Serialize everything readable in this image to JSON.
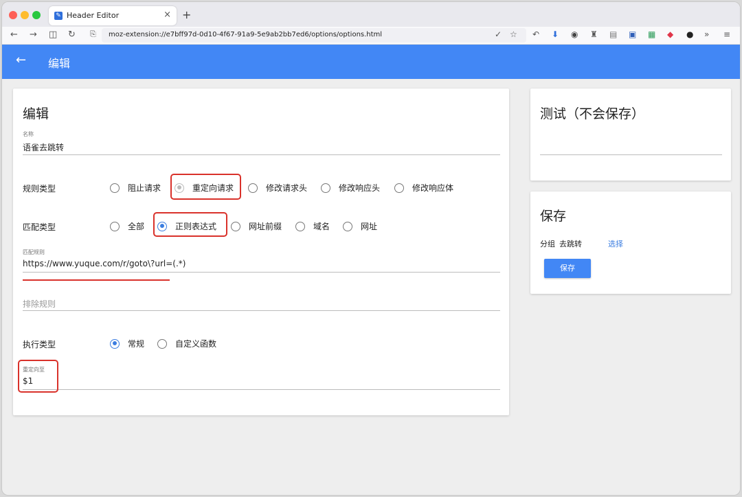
{
  "browser": {
    "tab_title": "Header Editor",
    "tab_close": "×",
    "new_tab": "+",
    "url": "moz-extension://e7bff97d-0d10-4f67-91a9-5e9ab2bb7ed6/options/options.html"
  },
  "appbar": {
    "back": "←",
    "title": "编辑"
  },
  "edit": {
    "title": "编辑",
    "name_label": "名称",
    "name_value": "语雀去跳转",
    "rule_type_label": "规则类型",
    "rule_types": [
      "阻止请求",
      "重定向请求",
      "修改请求头",
      "修改响应头",
      "修改响应体"
    ],
    "rule_type_selected": "重定向请求",
    "match_type_label": "匹配类型",
    "match_types": [
      "全部",
      "正则表达式",
      "网址前缀",
      "域名",
      "网址"
    ],
    "match_type_selected": "正则表达式",
    "match_rule_label": "匹配规则",
    "match_rule_value": "https://www.yuque.com/r/goto\\?url=(.*)",
    "exclude_placeholder": "排除规则",
    "exec_type_label": "执行类型",
    "exec_types": [
      "常规",
      "自定义函数"
    ],
    "exec_type_selected": "常规",
    "redirect_label": "重定向至",
    "redirect_value": "$1"
  },
  "test": {
    "title": "测试（不会保存）"
  },
  "save": {
    "title": "保存",
    "group_label": "分组",
    "group_value": "去跳转",
    "choose": "选择",
    "button": "保存"
  },
  "colors": {
    "accent": "#4287f5",
    "annotation": "#d9312a"
  }
}
